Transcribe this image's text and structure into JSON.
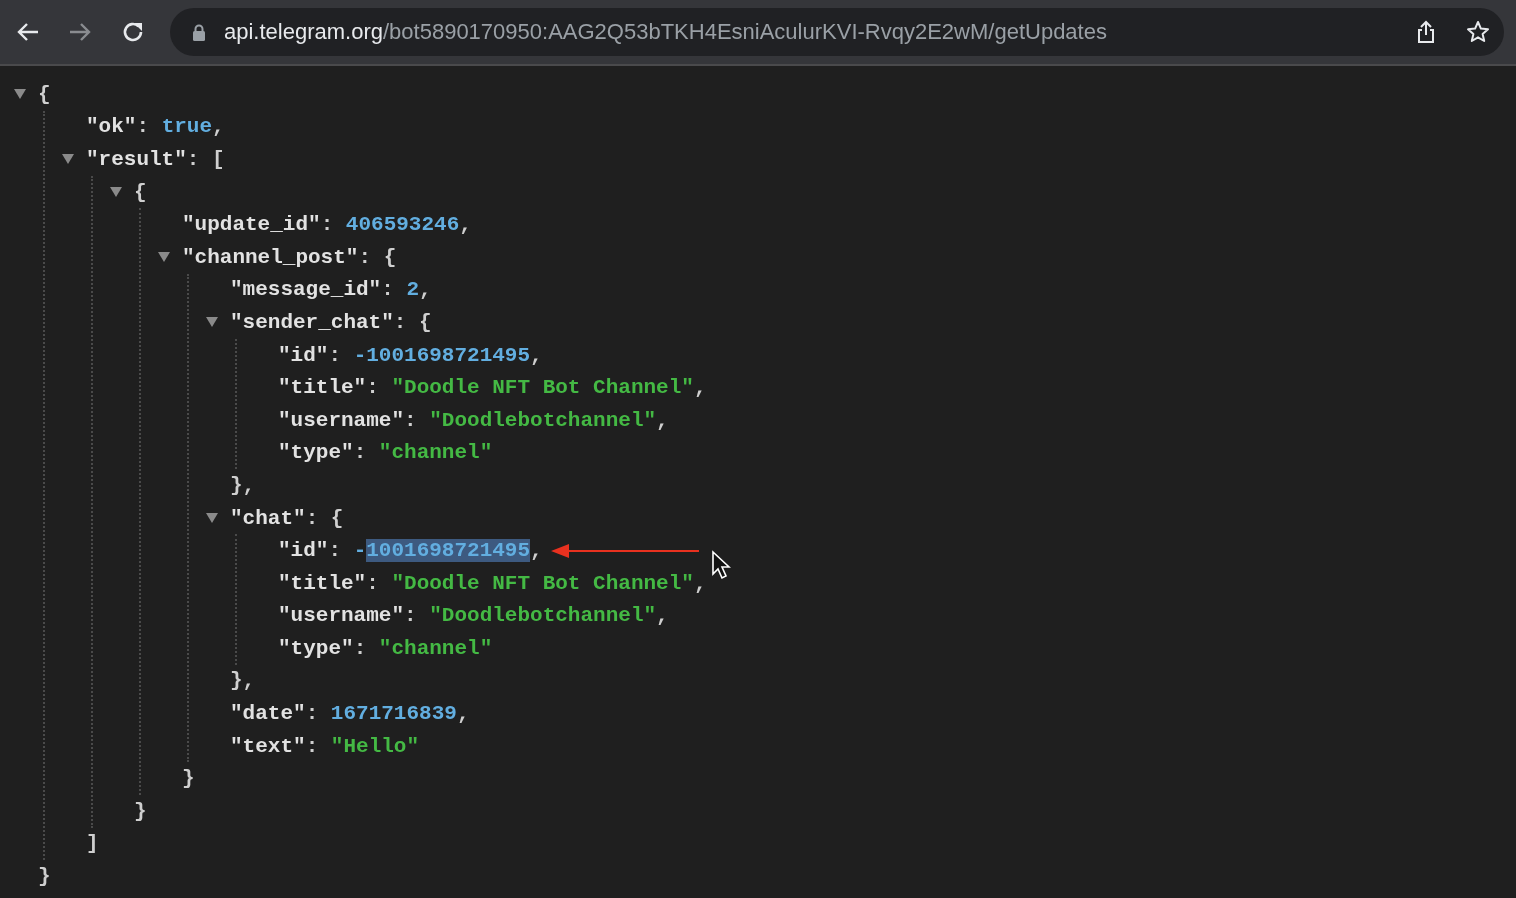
{
  "toolbar": {
    "back_enabled": true,
    "forward_enabled": false
  },
  "address_bar": {
    "host": "api.telegram.org",
    "path": "/bot5890170950:AAG2Q53bTKH4EsniAculurKVI-Rvqy2E2wM/getUpdates"
  },
  "tree": {
    "open": "{",
    "close": "}",
    "expanded": true,
    "children": [
      {
        "key": "\"ok\"",
        "sep": ":",
        "value": "true",
        "kind": "bool",
        "trail": ","
      },
      {
        "key": "\"result\"",
        "sep": ":",
        "open": "[",
        "close": "]",
        "expanded": true,
        "children": [
          {
            "open": "{",
            "close": "}",
            "expanded": true,
            "children": [
              {
                "key": "\"update_id\"",
                "sep": ":",
                "value": "406593246",
                "kind": "number",
                "trail": ","
              },
              {
                "key": "\"channel_post\"",
                "sep": ":",
                "open": "{",
                "close": "}",
                "expanded": true,
                "children": [
                  {
                    "key": "\"message_id\"",
                    "sep": ":",
                    "value": "2",
                    "kind": "number",
                    "trail": ","
                  },
                  {
                    "key": "\"sender_chat\"",
                    "sep": ":",
                    "open": "{",
                    "close": "}",
                    "trail": ",",
                    "expanded": true,
                    "children": [
                      {
                        "key": "\"id\"",
                        "sep": ":",
                        "value": "-1001698721495",
                        "kind": "number",
                        "trail": ","
                      },
                      {
                        "key": "\"title\"",
                        "sep": ":",
                        "value": "\"Doodle NFT Bot Channel\"",
                        "kind": "string",
                        "trail": ","
                      },
                      {
                        "key": "\"username\"",
                        "sep": ":",
                        "value": "\"Doodlebotchannel\"",
                        "kind": "string",
                        "trail": ","
                      },
                      {
                        "key": "\"type\"",
                        "sep": ":",
                        "value": "\"channel\"",
                        "kind": "string"
                      }
                    ]
                  },
                  {
                    "key": "\"chat\"",
                    "sep": ":",
                    "open": "{",
                    "close": "}",
                    "trail": ",",
                    "expanded": true,
                    "children": [
                      {
                        "key": "\"id\"",
                        "sep": ":",
                        "value": "-",
                        "selection": "1001698721495",
                        "kind": "number",
                        "trail": ",",
                        "pointer_arrow": true
                      },
                      {
                        "key": "\"title\"",
                        "sep": ":",
                        "value": "\"Doodle NFT Bot Channel\"",
                        "kind": "string",
                        "trail": ","
                      },
                      {
                        "key": "\"username\"",
                        "sep": ":",
                        "value": "\"Doodlebotchannel\"",
                        "kind": "string",
                        "trail": ","
                      },
                      {
                        "key": "\"type\"",
                        "sep": ":",
                        "value": "\"channel\"",
                        "kind": "string"
                      }
                    ]
                  },
                  {
                    "key": "\"date\"",
                    "sep": ":",
                    "value": "1671716839",
                    "kind": "number",
                    "trail": ","
                  },
                  {
                    "key": "\"text\"",
                    "sep": ":",
                    "value": "\"Hello\"",
                    "kind": "string"
                  }
                ]
              }
            ]
          }
        ]
      }
    ]
  }
}
